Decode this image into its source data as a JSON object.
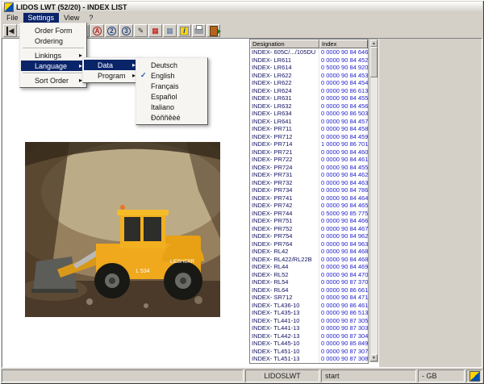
{
  "window": {
    "title": "LIDOS LWT (52/20) - INDEX LIST"
  },
  "menubar": {
    "items": [
      {
        "id": "file",
        "label": "File"
      },
      {
        "id": "settings",
        "label": "Settings",
        "active": true
      },
      {
        "id": "view",
        "label": "View"
      },
      {
        "id": "help",
        "label": "?"
      }
    ]
  },
  "menus": {
    "settings": {
      "items": [
        {
          "id": "order-form",
          "label": "Order Form"
        },
        {
          "id": "ordering",
          "label": "Ordering"
        },
        {
          "type": "separator"
        },
        {
          "id": "linkings",
          "label": "Linkings",
          "submenu": true
        },
        {
          "id": "language",
          "label": "Language",
          "submenu": true,
          "active": true
        },
        {
          "type": "separator"
        },
        {
          "id": "sort-order",
          "label": "Sort Order",
          "submenu": true
        }
      ]
    },
    "language": {
      "items": [
        {
          "id": "data",
          "label": "Data",
          "submenu": true,
          "active": true
        },
        {
          "id": "program",
          "label": "Program",
          "submenu": true
        }
      ]
    },
    "language_data": {
      "items": [
        {
          "id": "deutsch",
          "label": "Deutsch"
        },
        {
          "id": "english",
          "label": "English",
          "checked": true
        },
        {
          "id": "francais",
          "label": "Français"
        },
        {
          "id": "espanol",
          "label": "Español"
        },
        {
          "id": "italiano",
          "label": "Italiano"
        },
        {
          "id": "russian",
          "label": "Ðóññêèé"
        }
      ]
    }
  },
  "toolbar": {
    "icons": [
      {
        "id": "nav-first-icon",
        "glyph": "◀",
        "cls": "bar-left",
        "fg": "#222222"
      },
      {
        "id": "nav-prev-icon",
        "glyph": "◀",
        "fg": "#222222"
      },
      {
        "id": "nav-next-icon",
        "glyph": "▶",
        "fg": "#222222"
      },
      {
        "id": "nav-last-icon",
        "glyph": "▶",
        "cls": "bar-right",
        "fg": "#222222"
      },
      {
        "id": "parts-doc-icon",
        "glyph": "▤",
        "fg": "#606060"
      },
      {
        "id": "catalog-doc-icon",
        "glyph": "▥",
        "fg": "#606060"
      },
      {
        "id": "zoom-area-a-icon",
        "glyph": "A",
        "cls": "circle-glyph",
        "fg": "#b02020"
      },
      {
        "id": "zoom-area-2-icon",
        "glyph": "2",
        "cls": "circle-glyph",
        "fg": "#204080"
      },
      {
        "id": "zoom-area-3-icon",
        "glyph": "3",
        "cls": "circle-glyph",
        "fg": "#204080"
      },
      {
        "id": "order-edit-icon",
        "glyph": "✎",
        "fg": "#303030"
      },
      {
        "id": "table-red-icon",
        "glyph": "▦",
        "fg": "#c00000"
      },
      {
        "id": "table-blue-icon",
        "glyph": "▦",
        "fg": "#5878a0"
      },
      {
        "id": "info-icon",
        "glyph": "i",
        "cls": "badge",
        "fg": "#0040c0",
        "bg": "#ffd400"
      },
      {
        "id": "print-icon",
        "cls": "printer"
      },
      {
        "id": "exit-icon",
        "cls": "door"
      }
    ]
  },
  "photo": {
    "machine_brand": "LIEBHERR",
    "machine_model": "L 534"
  },
  "table": {
    "columns": [
      "Designation",
      "Index"
    ],
    "rows": [
      [
        "INDEX- 605C/.../105DU",
        "0 0000 90 84 646"
      ],
      [
        "INDEX- LR611",
        "0 0000 90 84 452"
      ],
      [
        "INDEX- LR614",
        "0 5000 90 84 920"
      ],
      [
        "INDEX- LR622",
        "0 0000 90 84 453"
      ],
      [
        "INDEX- LR622",
        "0 0000 90 84 454"
      ],
      [
        "INDEX- LR624",
        "0 0000 90 86 613"
      ],
      [
        "INDEX- LR631",
        "0 0000 90 84 455"
      ],
      [
        "INDEX- LR632",
        "0 0000 90 84 456"
      ],
      [
        "INDEX- LR634",
        "0 0000 90 86 503"
      ],
      [
        "INDEX- LR641",
        "0 0000 90 84 457"
      ],
      [
        "INDEX- PR711",
        "0 0000 90 84 458"
      ],
      [
        "INDEX- PR712",
        "0 0000 90 84 459"
      ],
      [
        "INDEX- PR714",
        "1 0000 90 86 701"
      ],
      [
        "INDEX- PR721",
        "0 0000 90 84 460"
      ],
      [
        "INDEX- PR722",
        "0 0000 90 84 461"
      ],
      [
        "INDEX- PR724",
        "0 0000 90 84 455"
      ],
      [
        "INDEX- PR731",
        "0 0000 90 84 462"
      ],
      [
        "INDEX- PR732",
        "0 0000 90 84 463"
      ],
      [
        "INDEX- PR734",
        "0 0000 90 84 786"
      ],
      [
        "INDEX- PR741",
        "0 0000 90 84 464"
      ],
      [
        "INDEX- PR742",
        "0 0000 90 84 465"
      ],
      [
        "INDEX- PR744",
        "0 5000 90 85 775"
      ],
      [
        "INDEX- PR751",
        "0 0000 90 84 466"
      ],
      [
        "INDEX- PR752",
        "0 0000 90 84 467"
      ],
      [
        "INDEX- PR754",
        "0 0000 90 84 962"
      ],
      [
        "INDEX- PR764",
        "0 0000 90 84 963"
      ],
      [
        "INDEX- RL42",
        "0 0000 90 84 468"
      ],
      [
        "INDEX- RL422/RL22B",
        "0 0000 90 84 468"
      ],
      [
        "INDEX- RL44",
        "0 0000 90 84 469"
      ],
      [
        "INDEX- RL52",
        "0 0000 90 84 470"
      ],
      [
        "INDEX- RL54",
        "0 0000 90 87 370"
      ],
      [
        "INDEX- RL64",
        "0 0000 90 86 661"
      ],
      [
        "INDEX- SR712",
        "0 0000 90 84 471"
      ],
      [
        "INDEX- TL436-10",
        "0 0000 90 86 461"
      ],
      [
        "INDEX- TL435-13",
        "0 0000 90 86 513"
      ],
      [
        "INDEX- TL441-10",
        "0 0000 90 87 305"
      ],
      [
        "INDEX- TL441-13",
        "0 0000 90 87 303"
      ],
      [
        "INDEX- TL442-13",
        "0 0000 90 87 304"
      ],
      [
        "INDEX- TL445-10",
        "0 0000 90 85 849"
      ],
      [
        "INDEX- TL451-10",
        "0 0000 90 87 307"
      ],
      [
        "INDEX- TL451-13",
        "0 0000 90 87 308"
      ]
    ]
  },
  "statusbar": {
    "app_panel": "LIDOSLWT",
    "task_panel": "start",
    "language_panel": "- GB"
  },
  "colors": {
    "selection": "#0a246a",
    "liebherr_yellow": "#f0a81c",
    "designation_text": "#101060",
    "index_text": "#2222cc"
  }
}
